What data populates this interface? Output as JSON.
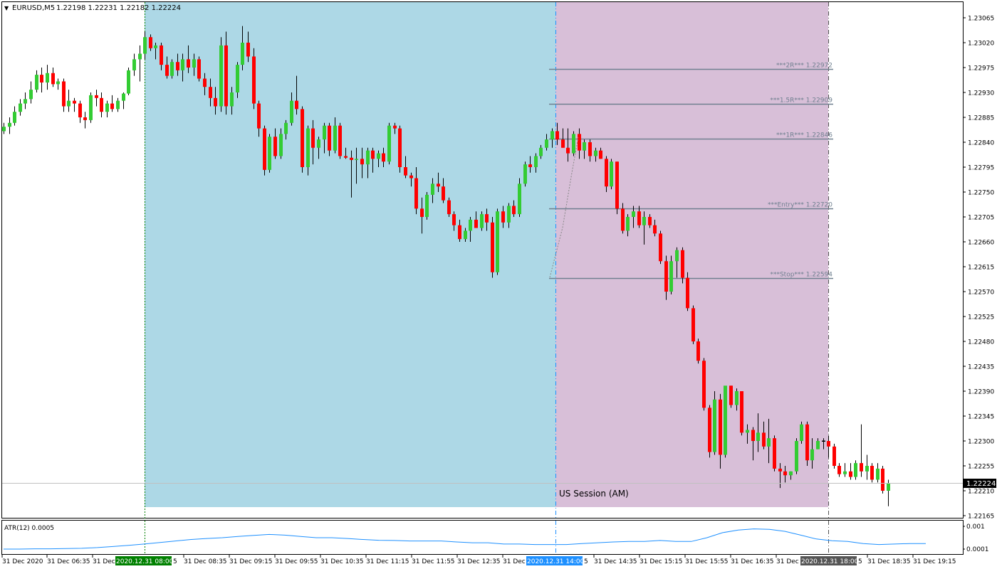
{
  "header": {
    "menu_glyph": "▼",
    "symbol": "EURUSD,M5",
    "ohlc": "1.22198 1.22231 1.22182 1.22224"
  },
  "price_axis": {
    "ticks": [
      "1.23065",
      "1.23020",
      "1.22975",
      "1.22930",
      "1.22885",
      "1.22840",
      "1.22795",
      "1.22750",
      "1.22705",
      "1.22660",
      "1.22615",
      "1.22570",
      "1.22525",
      "1.22480",
      "1.22435",
      "1.22390",
      "1.22345",
      "1.22300",
      "1.22255",
      "1.22210",
      "1.22165"
    ],
    "current_price_label": "1.22224"
  },
  "sessions": {
    "london_label": "",
    "us_am_label": "US Session (AM)"
  },
  "levels": [
    {
      "label": "***2R*** 1.22972",
      "price": 1.22972
    },
    {
      "label": "***1.5R*** 1.22909",
      "price": 1.22909
    },
    {
      "label": "***1R*** 1.22846",
      "price": 1.22846
    },
    {
      "label": "***Entry*** 1.22720",
      "price": 1.2272
    },
    {
      "label": "***Stop*** 1.22594",
      "price": 1.22594
    }
  ],
  "indicator": {
    "label": "ATR(12) 0.0005",
    "ticks": [
      "0.001",
      "0.0001"
    ]
  },
  "time_axis": {
    "labels": [
      "31 Dec 2020",
      "31 Dec 06:35",
      "31 Dec",
      "2020.12.31 08:00",
      "5",
      "31 Dec 08:35",
      "31 Dec 09:15",
      "31 Dec 09:55",
      "31 Dec 10:35",
      "31 Dec 11:15",
      "31 Dec 11:55",
      "31 Dec 12:35",
      "31 Dec",
      "2020.12.31 14:00",
      "5",
      "31 Dec 14:35",
      "31 Dec 15:15",
      "31 Dec 15:55",
      "31 Dec 16:35",
      "31 Dec",
      "2020.12.31 18:00",
      "5",
      "31 Dec 18:35",
      "31 Dec 19:15"
    ],
    "badge_colors": {
      "session_start": "#008000",
      "us_start": "#1e90ff",
      "us_end": "#555555"
    }
  },
  "colors": {
    "bull": "#33cc33",
    "bear": "#ff0000",
    "session_blue": "#add8e6",
    "session_pink": "#d8bfd8",
    "level_line": "#708090",
    "atr_line": "#1e90ff"
  },
  "chart_data": {
    "type": "candlestick",
    "symbol": "EURUSD",
    "timeframe": "M5",
    "ylim": [
      1.22145,
      1.2309
    ],
    "candles": [
      [
        1.2286,
        1.22875,
        1.22855,
        1.22868
      ],
      [
        1.22868,
        1.22885,
        1.22855,
        1.22875
      ],
      [
        1.22875,
        1.22905,
        1.2287,
        1.22895
      ],
      [
        1.22895,
        1.22918,
        1.22888,
        1.2291
      ],
      [
        1.2291,
        1.2293,
        1.229,
        1.22918
      ],
      [
        1.22918,
        1.2295,
        1.2291,
        1.22935
      ],
      [
        1.22935,
        1.2297,
        1.2293,
        1.22962
      ],
      [
        1.22962,
        1.22975,
        1.2293,
        1.22948
      ],
      [
        1.22948,
        1.2298,
        1.22935,
        1.22965
      ],
      [
        1.22965,
        1.22975,
        1.2294,
        1.22945
      ],
      [
        1.22945,
        1.22955,
        1.22935,
        1.2295
      ],
      [
        1.2295,
        1.22955,
        1.22895,
        1.22905
      ],
      [
        1.22905,
        1.22935,
        1.22895,
        1.22915
      ],
      [
        1.22915,
        1.2292,
        1.22895,
        1.2291
      ],
      [
        1.2291,
        1.22915,
        1.22875,
        1.22885
      ],
      [
        1.22885,
        1.22895,
        1.22865,
        1.2288
      ],
      [
        1.2288,
        1.2293,
        1.22875,
        1.22925
      ],
      [
        1.22925,
        1.22935,
        1.22905,
        1.2292
      ],
      [
        1.2292,
        1.2293,
        1.22885,
        1.22895
      ],
      [
        1.22895,
        1.22915,
        1.22885,
        1.2291
      ],
      [
        1.2291,
        1.22925,
        1.22895,
        1.229
      ],
      [
        1.229,
        1.2292,
        1.22895,
        1.22915
      ],
      [
        1.22915,
        1.2293,
        1.229,
        1.22928
      ],
      [
        1.22928,
        1.22975,
        1.22925,
        1.2297
      ],
      [
        1.2297,
        1.23,
        1.2296,
        1.2299
      ],
      [
        1.2299,
        1.23015,
        1.2295,
        1.23
      ],
      [
        1.23,
        1.2304,
        1.2299,
        1.2303
      ],
      [
        1.2303,
        1.23035,
        1.23005,
        1.2301
      ],
      [
        1.2301,
        1.2302,
        1.2299,
        1.23015
      ],
      [
        1.23015,
        1.2302,
        1.2297,
        1.2298
      ],
      [
        1.2298,
        1.22995,
        1.22955,
        1.2296
      ],
      [
        1.2296,
        1.2299,
        1.22955,
        1.22985
      ],
      [
        1.22985,
        1.23,
        1.2296,
        1.2297
      ],
      [
        1.2297,
        1.23,
        1.2295,
        1.2299
      ],
      [
        1.2299,
        1.23015,
        1.22965,
        1.22975
      ],
      [
        1.22975,
        1.23,
        1.2296,
        1.2299
      ],
      [
        1.2299,
        1.22995,
        1.2295,
        1.22955
      ],
      [
        1.22955,
        1.22965,
        1.22925,
        1.2294
      ],
      [
        1.2294,
        1.22955,
        1.22905,
        1.2292
      ],
      [
        1.2292,
        1.2294,
        1.2289,
        1.22905
      ],
      [
        1.22905,
        1.2303,
        1.22895,
        1.23015
      ],
      [
        1.23015,
        1.2304,
        1.2289,
        1.22905
      ],
      [
        1.22905,
        1.2294,
        1.2289,
        1.2293
      ],
      [
        1.2293,
        1.22985,
        1.2292,
        1.2298
      ],
      [
        1.2298,
        1.2305,
        1.2297,
        1.2302
      ],
      [
        1.2302,
        1.2304,
        1.22985,
        1.22995
      ],
      [
        1.22995,
        1.2301,
        1.229,
        1.2291
      ],
      [
        1.2291,
        1.22915,
        1.2285,
        1.22865
      ],
      [
        1.22865,
        1.2287,
        1.2278,
        1.2279
      ],
      [
        1.2279,
        1.22855,
        1.22785,
        1.2285
      ],
      [
        1.2285,
        1.22865,
        1.2281,
        1.22815
      ],
      [
        1.22815,
        1.22865,
        1.2281,
        1.22855
      ],
      [
        1.22855,
        1.2288,
        1.22845,
        1.22875
      ],
      [
        1.22875,
        1.2293,
        1.2287,
        1.22915
      ],
      [
        1.22915,
        1.2296,
        1.2289,
        1.229
      ],
      [
        1.229,
        1.22905,
        1.22785,
        1.22795
      ],
      [
        1.22795,
        1.2287,
        1.2278,
        1.22865
      ],
      [
        1.22865,
        1.2288,
        1.228,
        1.2283
      ],
      [
        1.2283,
        1.2285,
        1.2281,
        1.22845
      ],
      [
        1.22845,
        1.22875,
        1.2282,
        1.2287
      ],
      [
        1.2287,
        1.22875,
        1.22815,
        1.22825
      ],
      [
        1.22825,
        1.22885,
        1.2282,
        1.2287
      ],
      [
        1.2287,
        1.22875,
        1.2281,
        1.22815
      ],
      [
        1.22815,
        1.2283,
        1.2281,
        1.22812
      ],
      [
        1.22812,
        1.22825,
        1.2274,
        1.22808
      ],
      [
        1.22808,
        1.2283,
        1.22765,
        1.2281
      ],
      [
        1.2281,
        1.2283,
        1.22775,
        1.228
      ],
      [
        1.228,
        1.2283,
        1.22775,
        1.22825
      ],
      [
        1.22825,
        1.2283,
        1.22785,
        1.2281
      ],
      [
        1.2281,
        1.22825,
        1.22795,
        1.2282
      ],
      [
        1.2282,
        1.2283,
        1.22795,
        1.22805
      ],
      [
        1.22805,
        1.22875,
        1.228,
        1.2287
      ],
      [
        1.2287,
        1.22875,
        1.22855,
        1.22865
      ],
      [
        1.22865,
        1.2287,
        1.22785,
        1.22795
      ],
      [
        1.22795,
        1.22815,
        1.22775,
        1.2278
      ],
      [
        1.2278,
        1.22785,
        1.2276,
        1.22775
      ],
      [
        1.22775,
        1.22795,
        1.2271,
        1.2272
      ],
      [
        1.2272,
        1.2274,
        1.22675,
        1.22705
      ],
      [
        1.22705,
        1.2275,
        1.227,
        1.22745
      ],
      [
        1.22745,
        1.22775,
        1.2273,
        1.22765
      ],
      [
        1.22765,
        1.22785,
        1.2275,
        1.2276
      ],
      [
        1.2276,
        1.22775,
        1.2273,
        1.22735
      ],
      [
        1.22735,
        1.2274,
        1.22705,
        1.2271
      ],
      [
        1.2271,
        1.22715,
        1.2268,
        1.2269
      ],
      [
        1.2269,
        1.227,
        1.2266,
        1.22665
      ],
      [
        1.22665,
        1.22685,
        1.2266,
        1.2268
      ],
      [
        1.2268,
        1.22705,
        1.2266,
        1.227
      ],
      [
        1.227,
        1.22715,
        1.22685,
        1.22685
      ],
      [
        1.22685,
        1.22715,
        1.2268,
        1.2271
      ],
      [
        1.2271,
        1.2272,
        1.2268,
        1.22695
      ],
      [
        1.22695,
        1.22705,
        1.22595,
        1.22605
      ],
      [
        1.22605,
        1.2272,
        1.226,
        1.22715
      ],
      [
        1.22715,
        1.22725,
        1.22685,
        1.22695
      ],
      [
        1.22695,
        1.2273,
        1.22685,
        1.22725
      ],
      [
        1.22725,
        1.22735,
        1.22705,
        1.2271
      ],
      [
        1.2271,
        1.22775,
        1.22705,
        1.22765
      ],
      [
        1.22765,
        1.22805,
        1.2276,
        1.228
      ],
      [
        1.228,
        1.22815,
        1.22785,
        1.22795
      ],
      [
        1.22795,
        1.2282,
        1.22785,
        1.22815
      ],
      [
        1.22815,
        1.22835,
        1.2281,
        1.2283
      ],
      [
        1.2283,
        1.22855,
        1.22825,
        1.22845
      ],
      [
        1.22845,
        1.22865,
        1.2283,
        1.2286
      ],
      [
        1.2286,
        1.22875,
        1.22835,
        1.22845
      ],
      [
        1.22845,
        1.22865,
        1.2283,
        1.2283
      ],
      [
        1.2283,
        1.22865,
        1.22805,
        1.2282
      ],
      [
        1.2282,
        1.2286,
        1.22815,
        1.22855
      ],
      [
        1.22855,
        1.22865,
        1.2281,
        1.22825
      ],
      [
        1.22825,
        1.22845,
        1.2281,
        1.2284
      ],
      [
        1.2284,
        1.22845,
        1.22805,
        1.22815
      ],
      [
        1.22815,
        1.2283,
        1.22805,
        1.22825
      ],
      [
        1.22825,
        1.2283,
        1.2281,
        1.2281
      ],
      [
        1.2281,
        1.22815,
        1.2275,
        1.2276
      ],
      [
        1.2276,
        1.2281,
        1.22755,
        1.22805
      ],
      [
        1.22805,
        1.22805,
        1.2271,
        1.2272
      ],
      [
        1.2272,
        1.2273,
        1.22675,
        1.2268
      ],
      [
        1.2268,
        1.2271,
        1.2267,
        1.22705
      ],
      [
        1.22705,
        1.22725,
        1.22685,
        1.22715
      ],
      [
        1.22715,
        1.22725,
        1.22685,
        1.2269
      ],
      [
        1.2269,
        1.22715,
        1.22655,
        1.22705
      ],
      [
        1.22705,
        1.2271,
        1.22685,
        1.2269
      ],
      [
        1.2269,
        1.227,
        1.2267,
        1.22675
      ],
      [
        1.22675,
        1.2268,
        1.2262,
        1.22625
      ],
      [
        1.22625,
        1.22635,
        1.22555,
        1.2257
      ],
      [
        1.2257,
        1.22635,
        1.22565,
        1.22625
      ],
      [
        1.22625,
        1.2265,
        1.22595,
        1.22645
      ],
      [
        1.22645,
        1.2265,
        1.22585,
        1.22595
      ],
      [
        1.22595,
        1.22605,
        1.22535,
        1.2254
      ],
      [
        1.2254,
        1.22545,
        1.22475,
        1.2248
      ],
      [
        1.2248,
        1.22485,
        1.2244,
        1.22445
      ],
      [
        1.22445,
        1.2245,
        1.22355,
        1.2236
      ],
      [
        1.2236,
        1.22365,
        1.2227,
        1.2228
      ],
      [
        1.2228,
        1.2239,
        1.22275,
        1.22375
      ],
      [
        1.22375,
        1.22385,
        1.2225,
        1.22275
      ],
      [
        1.22275,
        1.22385,
        1.2227,
        1.224
      ],
      [
        1.224,
        1.224,
        1.2236,
        1.22365
      ],
      [
        1.22365,
        1.22395,
        1.22355,
        1.2239
      ],
      [
        1.2239,
        1.2239,
        1.2231,
        1.22315
      ],
      [
        1.22315,
        1.2233,
        1.22295,
        1.2232
      ],
      [
        1.2232,
        1.22325,
        1.22265,
        1.223
      ],
      [
        1.223,
        1.2235,
        1.2228,
        1.22315
      ],
      [
        1.22315,
        1.22335,
        1.22285,
        1.2229
      ],
      [
        1.2229,
        1.2234,
        1.2226,
        1.22305
      ],
      [
        1.22305,
        1.2231,
        1.22245,
        1.2225
      ],
      [
        1.2225,
        1.2226,
        1.22215,
        1.22245
      ],
      [
        1.22245,
        1.22255,
        1.22225,
        1.22238
      ],
      [
        1.22238,
        1.22245,
        1.2223,
        1.22245
      ],
      [
        1.22245,
        1.22305,
        1.2224,
        1.223
      ],
      [
        1.223,
        1.22335,
        1.22295,
        1.2233
      ],
      [
        1.2233,
        1.22335,
        1.22255,
        1.22265
      ],
      [
        1.22265,
        1.22305,
        1.2225,
        1.22285
      ],
      [
        1.22285,
        1.22305,
        1.22285,
        1.223
      ],
      [
        1.223,
        1.22305,
        1.22285,
        1.223
      ],
      [
        1.223,
        1.2231,
        1.2227,
        1.2229
      ],
      [
        1.2229,
        1.22295,
        1.2225,
        1.22255
      ],
      [
        1.22255,
        1.2226,
        1.22235,
        1.2224
      ],
      [
        1.2224,
        1.2226,
        1.22235,
        1.22245
      ],
      [
        1.22245,
        1.2226,
        1.2223,
        1.22235
      ],
      [
        1.22235,
        1.22265,
        1.2223,
        1.2226
      ],
      [
        1.2226,
        1.2233,
        1.22235,
        1.22245
      ],
      [
        1.22245,
        1.22275,
        1.2223,
        1.22255
      ],
      [
        1.22255,
        1.2226,
        1.22225,
        1.2223
      ],
      [
        1.2223,
        1.2226,
        1.22225,
        1.2225
      ],
      [
        1.2225,
        1.22255,
        1.22205,
        1.2221
      ],
      [
        1.2221,
        1.2223,
        1.22182,
        1.22224
      ]
    ],
    "atr": [
      0.0001,
      0.0001,
      0.00011,
      0.00011,
      0.00012,
      0.00013,
      0.00016,
      0.0002,
      0.00025,
      0.0003,
      0.00036,
      0.00042,
      0.00048,
      0.00052,
      0.00055,
      0.0006,
      0.00064,
      0.00068,
      0.00065,
      0.0006,
      0.00055,
      0.00055,
      0.00052,
      0.00048,
      0.00045,
      0.00044,
      0.00042,
      0.00042,
      0.00042,
      0.00038,
      0.00035,
      0.00035,
      0.0003,
      0.0003,
      0.00028,
      0.00028,
      0.00028,
      0.00032,
      0.00035,
      0.00038,
      0.0004,
      0.0004,
      0.00044,
      0.0004,
      0.0004,
      0.00055,
      0.00075,
      0.00085,
      0.0009,
      0.00088,
      0.0008,
      0.00065,
      0.0005,
      0.00043,
      0.0004,
      0.00032,
      0.00028,
      0.0003,
      0.00032,
      0.00032
    ]
  }
}
